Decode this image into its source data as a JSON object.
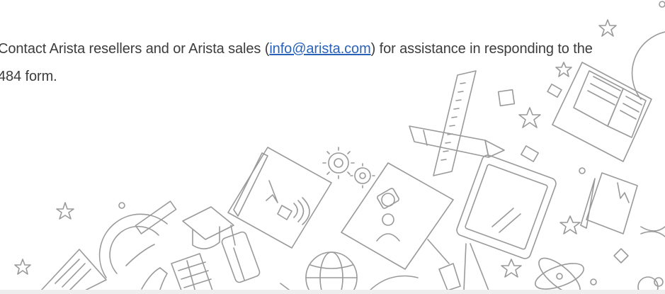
{
  "paragraph": {
    "before_link": "Contact Arista resellers and or Arista sales (",
    "link_text": "info@arista.com",
    "after_link": ") for assistance in responding to the 484 form."
  },
  "colors": {
    "text": "#3c3c3c",
    "link": "#2a62b8",
    "line_art": "#9a9a9a"
  },
  "decorative_icons": [
    "star-icon",
    "book-icon",
    "ruler-icon",
    "pencil-icon",
    "gears-icon",
    "presentation-board-icon",
    "tablet-icon",
    "graduation-cap-icon",
    "protractor-icon",
    "globe-icon",
    "atom-icon",
    "compass-icon",
    "smartphone-icon",
    "calculator-icon",
    "open-book-icon"
  ]
}
